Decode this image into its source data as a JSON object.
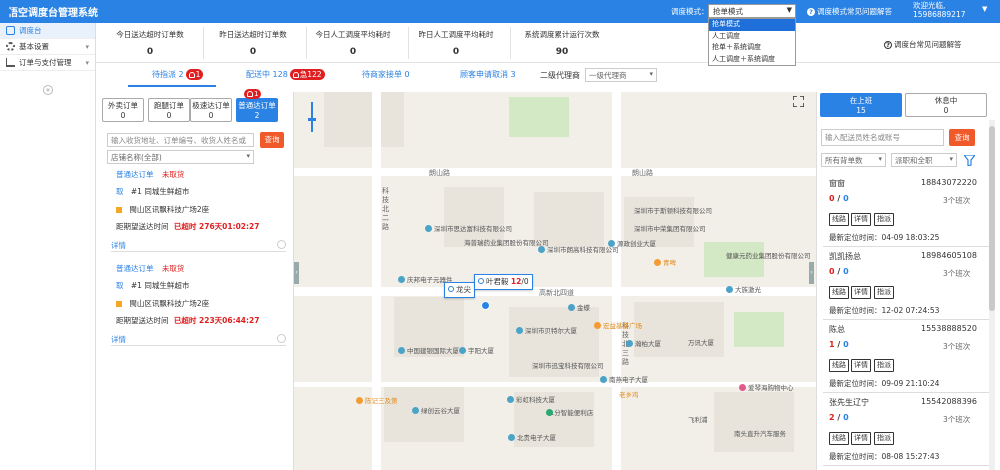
{
  "app": {
    "title": "悟空调度台管理系统"
  },
  "topbar": {
    "mode_label": "调度模式：",
    "mode_selected": "抢单模式",
    "mode_options": [
      "抢单模式",
      "人工调度",
      "抢单＋系统调度",
      "人工调度＋系统调度"
    ],
    "help": "调度模式常见问题解答",
    "welcome": "欢迎光临,",
    "phone": "15986889217"
  },
  "sidebar": {
    "items": [
      {
        "label": "调度台",
        "icon": "dispatch-icon"
      },
      {
        "label": "基本设置",
        "icon": "gear-icon"
      },
      {
        "label": "订单与支付管理",
        "icon": "cart-icon"
      }
    ]
  },
  "stats": [
    {
      "label": "今日送达超时订单数",
      "value": "0"
    },
    {
      "label": "昨日送达超时订单数",
      "value": "0"
    },
    {
      "label": "今日人工调度平均耗时",
      "value": "0"
    },
    {
      "label": "昨日人工调度平均耗时",
      "value": "0"
    },
    {
      "label": "系统调度累计运行次数",
      "value": "90"
    }
  ],
  "help_link": "调度台常见问题解答",
  "tabs": [
    {
      "label": "待指派 2",
      "badge": "1"
    },
    {
      "label": "配送中 128",
      "badge": "急122"
    },
    {
      "label": "待商家接单 0",
      "badge": ""
    },
    {
      "label": "顾客申请取消 3",
      "badge": ""
    }
  ],
  "agent": {
    "label": "二级代理商",
    "placeholder": "一级代理商"
  },
  "order_types": [
    {
      "label": "外卖订单",
      "count": "0"
    },
    {
      "label": "跑腿订单",
      "count": "0"
    },
    {
      "label": "极速达订单",
      "count": "0"
    },
    {
      "label": "普通达订单",
      "count": "2",
      "badge": "1"
    }
  ],
  "order_search": {
    "placeholder": "输入收货地址、订单编号、收货人姓名或",
    "button": "查询",
    "shop_select": "店铺名称(全部)"
  },
  "orders": [
    {
      "type": "普通达订单",
      "status": "未取货",
      "pickup_prefix": "取",
      "shop": "#1 同城生鲜超市",
      "address": "閩山区讯飘科技广场2座",
      "time_label": "距期望送达时间",
      "time": "已超时 276天01:02:27",
      "detail": "详情"
    },
    {
      "type": "普通达订单",
      "status": "未取货",
      "pickup_prefix": "取",
      "shop": "#1 同城生鲜超市",
      "address": "閩山区讯飘科技广场2座",
      "time_label": "距期望送达时间",
      "time": "已超时 223天06:44:27",
      "detail": "详情"
    }
  ],
  "map": {
    "roads": [
      "朗山路",
      "朗山路",
      "科技北二路",
      "高新北四道",
      "科技北三路"
    ],
    "pois": [
      "深圳市思达富科技有限公司",
      "海普瑞药业集团股份有限公司",
      "深圳市朗高科技有限公司",
      "源政创业大厦",
      "深圳市于斯顿科技有限公司",
      "深圳市中荣集团有限公司",
      "庆邦电子元器件",
      "健康元药业集团股份有限公司",
      "青啤",
      "中国建银国际大厦",
      "宇阳大厦",
      "深圳市贝特尔大厦",
      "深圳市迅宝科技有限公司",
      "金蝶",
      "宏益基督广场",
      "瀚柏大厦",
      "万讯大厦",
      "南燕电子大厦",
      "老乡鸡",
      "绿创云谷大厦",
      "彩虹科技大厦",
      "11分智能便利店",
      "北贵电子大厦",
      "南头直升汽车服务",
      "陈记三及第",
      "大族激光",
      "爱琴海购物中心",
      "飞利浦"
    ],
    "riders": [
      {
        "name": "叶君毅",
        "assigned": "12",
        "total": "0"
      },
      {
        "name": "龙尖",
        "assigned": "",
        "total": ""
      }
    ]
  },
  "shift": {
    "on_label": "在上班",
    "on_count": "15",
    "off_label": "休息中",
    "off_count": "0"
  },
  "rider_search": {
    "placeholder": "输入配送员姓名或账号",
    "button": "查询",
    "filter1": "所有背单数",
    "filter2": "派职和全职"
  },
  "riders": [
    {
      "name": "窗窗",
      "phone": "18843072220",
      "assigned": "0",
      "done": "0",
      "shifts": "3个班次",
      "last": "最新定位时间：04-09 18:03:25"
    },
    {
      "name": "凯凯扬总",
      "phone": "18984605108",
      "assigned": "0",
      "done": "0",
      "shifts": "3个班次",
      "last": "最新定位时间：12-02 07:24:53"
    },
    {
      "name": "陈总",
      "phone": "15538888520",
      "assigned": "1",
      "done": "0",
      "shifts": "3个班次",
      "last": "最新定位时间：09-09 21:10:24"
    },
    {
      "name": "张先生辽宁",
      "phone": "15542088396",
      "assigned": "2",
      "done": "0",
      "shifts": "3个班次",
      "last": "最新定位时间：08-08 15:27:43"
    }
  ],
  "rider_actions": [
    "线路",
    "详情",
    "指派"
  ],
  "colors": {
    "primary": "#2a82e4",
    "danger": "#e02020",
    "accent": "#f0592a"
  }
}
